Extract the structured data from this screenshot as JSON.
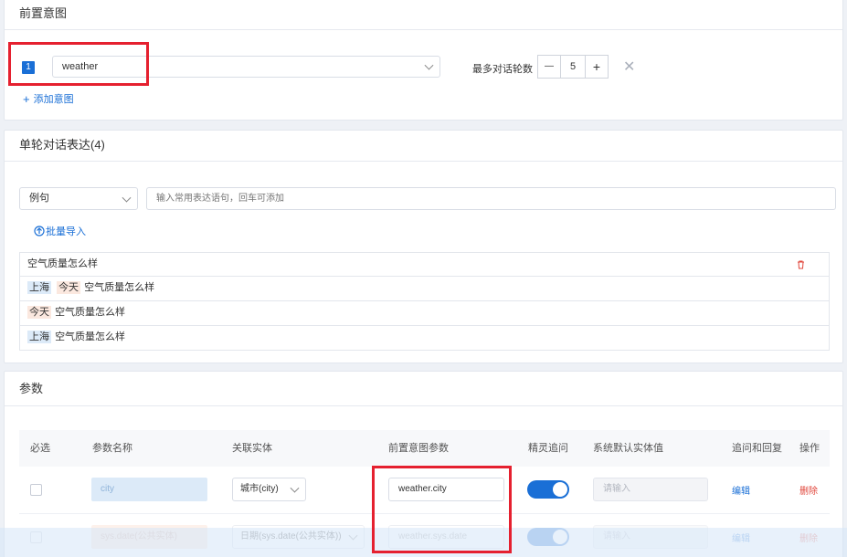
{
  "pre_intent": {
    "title": "前置意图",
    "item_index": "1",
    "intent_value": "weather",
    "max_turns_label": "最多对话轮数",
    "stepper_minus": "—",
    "stepper_value": "5",
    "stepper_plus": "+",
    "remove_symbol": "✕",
    "add_intent_plus": "+",
    "add_intent_label": "添加意图"
  },
  "single_turn": {
    "title": "单轮对话表达(4)",
    "type_select": "例句",
    "input_placeholder": "输入常用表达语句，回车可添加",
    "bulk_import_label": "批量导入",
    "rows": [
      {
        "text": "空气质量怎么样"
      },
      {
        "tag1": "上海",
        "tag2": "今天",
        "text": "空气质量怎么样"
      },
      {
        "tag1": "今天",
        "text": "空气质量怎么样"
      },
      {
        "tag1": "上海",
        "text": "空气质量怎么样"
      }
    ]
  },
  "params": {
    "title": "参数",
    "headers": {
      "required": "必选",
      "name": "参数名称",
      "entity": "关联实体",
      "pre_intent_param": "前置意图参数",
      "smart_followup": "精灵追问",
      "default_value": "系统默认实体值",
      "followup_reply": "追问和回复",
      "actions": "操作"
    },
    "rows": [
      {
        "name": "city",
        "entity": "城市(city)",
        "pre_param": "weather.city",
        "default_placeholder": "请输入",
        "edit": "编辑",
        "delete": "删除"
      },
      {
        "name": "sys.date(公共实体)",
        "entity": "日期(sys.date(公共实体))",
        "pre_param": "weather.sys.date",
        "default_placeholder": "请输入",
        "edit": "编辑",
        "delete": "删除"
      }
    ]
  },
  "colors": {
    "accent": "#1a6fd6",
    "highlight_red": "#e5202f",
    "delete_red": "#e0453a"
  }
}
